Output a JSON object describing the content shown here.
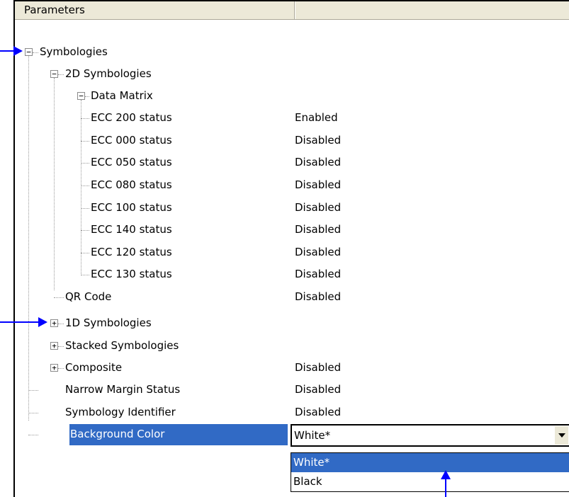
{
  "header": {
    "col1": "Parameters",
    "col2": ""
  },
  "tree": {
    "symbologies": "Symbologies",
    "sym2d": "2D Symbologies",
    "datamatrix": "Data Matrix",
    "ecc200": {
      "label": "ECC 200 status",
      "value": "Enabled"
    },
    "ecc000": {
      "label": "ECC 000 status",
      "value": "Disabled"
    },
    "ecc050": {
      "label": "ECC 050 status",
      "value": "Disabled"
    },
    "ecc080": {
      "label": "ECC 080 status",
      "value": "Disabled"
    },
    "ecc100": {
      "label": "ECC 100 status",
      "value": "Disabled"
    },
    "ecc140": {
      "label": "ECC 140 status",
      "value": "Disabled"
    },
    "ecc120": {
      "label": "ECC 120 status",
      "value": "Disabled"
    },
    "ecc130": {
      "label": "ECC 130 status",
      "value": "Disabled"
    },
    "qrcode": {
      "label": "QR Code",
      "value": "Disabled"
    },
    "sym1d": "1D Symbologies",
    "stacked": "Stacked Symbologies",
    "composite": {
      "label": "Composite",
      "value": "Disabled"
    },
    "narrow": {
      "label": "Narrow Margin Status",
      "value": "Disabled"
    },
    "symid": {
      "label": "Symbology Identifier",
      "value": "Disabled"
    },
    "bgcolor": {
      "label": "Background Color"
    }
  },
  "combo": {
    "value": "White*",
    "options": [
      "White*",
      "Black"
    ]
  },
  "colors": {
    "selection": "#316ac5",
    "header": "#ece9d8",
    "arrow": "#0000ff"
  }
}
